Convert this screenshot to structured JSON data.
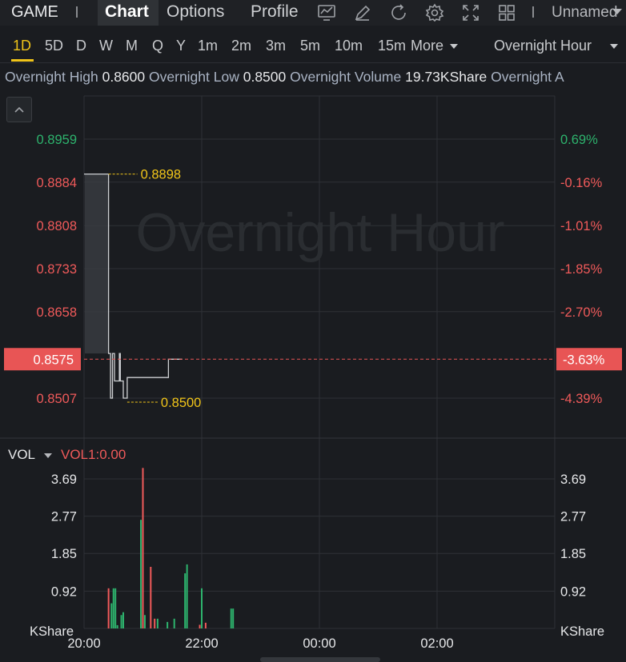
{
  "toolbar": {
    "ticker": "GAME",
    "tabs": [
      "Chart",
      "Options",
      "Profile"
    ],
    "active_tab": "Chart",
    "icons": [
      "indicator-icon",
      "draw-icon",
      "refresh-icon",
      "settings-icon",
      "fullscreen-icon",
      "layout-icon"
    ],
    "layout_name": "Unnamed"
  },
  "intervals": {
    "items": [
      "1D",
      "5D",
      "D",
      "W",
      "M",
      "Q",
      "Y",
      "1m",
      "2m",
      "3m",
      "5m",
      "10m",
      "15m"
    ],
    "active": "1D",
    "more_label": "More",
    "session_label": "Overnight Hour"
  },
  "infobar": {
    "high_label": "Overnight High",
    "high_value": "0.8600",
    "low_label": "Overnight Low",
    "low_value": "0.8500",
    "volume_label": "Overnight Volume",
    "volume_value": "19.73KShare",
    "avg_label": "Overnight A"
  },
  "chart_data": {
    "type": "line",
    "watermark": "Overnight Hour",
    "price_ticks": [
      "0.8959",
      "0.8884",
      "0.8808",
      "0.8733",
      "0.8658",
      "0.8507"
    ],
    "pct_ticks": [
      "0.69%",
      "-0.16%",
      "-1.01%",
      "-1.85%",
      "-2.70%",
      "-4.39%"
    ],
    "current_price": "0.8575",
    "current_pct": "-3.63%",
    "high_marker": "0.8898",
    "low_marker": "0.8500",
    "time_ticks": [
      "20:00",
      "22:00",
      "00:00",
      "02:00"
    ],
    "price_series": {
      "x": [
        "20:25",
        "20:25",
        "20:27",
        "20:27",
        "20:29",
        "20:29",
        "20:31",
        "20:31",
        "20:36",
        "20:36",
        "20:37",
        "20:37",
        "20:40",
        "20:40",
        "20:44",
        "20:44",
        "20:50",
        "20:50",
        "21:00",
        "21:00",
        "21:26",
        "21:26",
        "21:40"
      ],
      "y": [
        0.8898,
        0.8585,
        0.8585,
        0.8507,
        0.8507,
        0.8585,
        0.8585,
        0.8537,
        0.8537,
        0.8585,
        0.8585,
        0.8537,
        0.8537,
        0.8507,
        0.8507,
        0.8543,
        0.8543,
        0.8543,
        0.8543,
        0.8543,
        0.8543,
        0.8575,
        0.8575
      ]
    },
    "volume": {
      "label": "VOL",
      "indicator": "VOL1:0.00",
      "unit": "KShare",
      "ticks": [
        "3.69",
        "2.77",
        "1.85",
        "0.92"
      ],
      "bars": [
        {
          "t": "20:25",
          "v": 0.99,
          "dir": "down"
        },
        {
          "t": "20:28",
          "v": 0.62,
          "dir": "up"
        },
        {
          "t": "20:30",
          "v": 0.99,
          "dir": "up"
        },
        {
          "t": "20:32",
          "v": 0.99,
          "dir": "up"
        },
        {
          "t": "20:34",
          "v": 0.08,
          "dir": "up"
        },
        {
          "t": "20:38",
          "v": 0.33,
          "dir": "up"
        },
        {
          "t": "20:40",
          "v": 0.4,
          "dir": "up"
        },
        {
          "t": "20:58",
          "v": 2.68,
          "dir": "up"
        },
        {
          "t": "21:00",
          "v": 3.96,
          "dir": "down"
        },
        {
          "t": "21:02",
          "v": 0.33,
          "dir": "up"
        },
        {
          "t": "21:08",
          "v": 1.52,
          "dir": "down"
        },
        {
          "t": "21:12",
          "v": 0.24,
          "dir": "down"
        },
        {
          "t": "21:15",
          "v": 0.24,
          "dir": "up"
        },
        {
          "t": "21:25",
          "v": 0.16,
          "dir": "up"
        },
        {
          "t": "21:32",
          "v": 0.24,
          "dir": "up"
        },
        {
          "t": "21:43",
          "v": 1.36,
          "dir": "up"
        },
        {
          "t": "21:45",
          "v": 1.58,
          "dir": "up"
        },
        {
          "t": "21:58",
          "v": 0.09,
          "dir": "down"
        },
        {
          "t": "22:00",
          "v": 0.99,
          "dir": "up"
        },
        {
          "t": "22:04",
          "v": 0.14,
          "dir": "down"
        },
        {
          "t": "22:30",
          "v": 0.49,
          "dir": "up"
        },
        {
          "t": "22:32",
          "v": 0.49,
          "dir": "up"
        }
      ]
    }
  },
  "colors": {
    "up": "#2db36d",
    "down": "#f05a5a",
    "accent": "#f0c419",
    "current_price_bg": "#e85555"
  }
}
